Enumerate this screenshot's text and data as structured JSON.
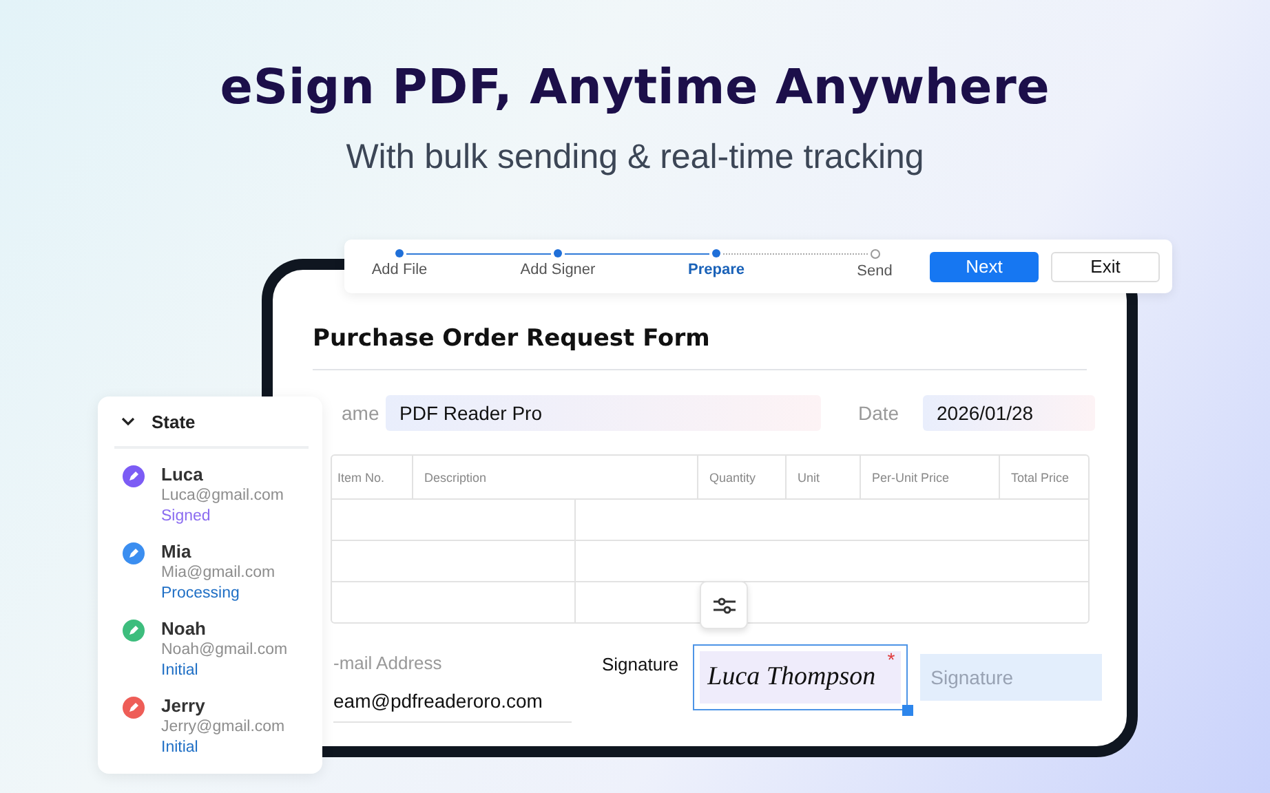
{
  "header": {
    "title": "eSign PDF, Anytime Anywhere",
    "subtitle": "With bulk sending & real-time tracking"
  },
  "steps": [
    {
      "label": "Add File",
      "selected": false
    },
    {
      "label": "Add Signer",
      "selected": false
    },
    {
      "label": "Prepare",
      "selected": true
    },
    {
      "label": "Send",
      "selected": false
    }
  ],
  "buttons": {
    "next": "Next",
    "exit": "Exit"
  },
  "form": {
    "title": "Purchase Order Request Form",
    "name_label": "ame",
    "name_value": "PDF Reader Pro",
    "date_label": "Date",
    "date_value": "2026/01/28",
    "columns": [
      "Item No.",
      "Description",
      "Quantity",
      "Unit",
      "Per-Unit Price",
      "Total Price"
    ],
    "email_label": "-mail Address",
    "email_value": "eam@pdfreaderoro.com",
    "signature_label": "Signature",
    "signature_value": "Luca Thompson",
    "required_mark": "*",
    "signature_placeholder": "Signature"
  },
  "state_panel": {
    "title": "State",
    "expanded": true,
    "signers": [
      {
        "name": "Luca",
        "email": "Luca@gmail.com",
        "status": "Signed",
        "kind": "signed",
        "color": "#7c5cf5"
      },
      {
        "name": "Mia",
        "email": "Mia@gmail.com",
        "status": "Processing",
        "kind": "processing",
        "color": "#3b8ef0"
      },
      {
        "name": "Noah",
        "email": "Noah@gmail.com",
        "status": "Initial",
        "kind": "initial",
        "color": "#3dbd7d"
      },
      {
        "name": "Jerry",
        "email": "Jerry@gmail.com",
        "status": "Initial",
        "kind": "initial",
        "color": "#ee5d57"
      }
    ]
  }
}
